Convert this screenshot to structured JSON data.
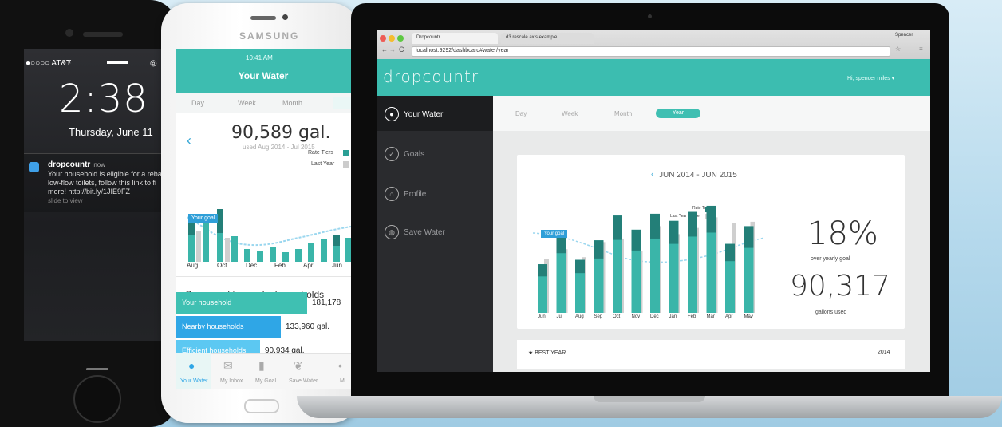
{
  "iphone": {
    "carrier": "●○○○○ AT&T",
    "time": "2:38",
    "date": "Thursday, June 11",
    "notification": {
      "app": "dropcountr",
      "age": "now",
      "lines": [
        "Your household is eligible for a reba",
        "low-flow toilets, follow this link to fi",
        "more!  http://bit.ly/1JIE9FZ"
      ],
      "hint": "slide to view"
    }
  },
  "samsung": {
    "brand": "SAMSUNG",
    "status_time": "10:41 AM",
    "title": "Your Water",
    "tabs": [
      "Day",
      "Week",
      "Month"
    ],
    "total": "90,589 gal.",
    "range": "used Aug 2014 - Jul 2015",
    "legend": [
      "Rate Tiers",
      "Last Year"
    ],
    "goal_label": "Your goal",
    "months": [
      "Aug",
      "Oct",
      "Dec",
      "Feb",
      "Apr",
      "Jun"
    ],
    "compare_title": "Compared to nearby households",
    "compare": [
      {
        "label": "Your household",
        "value": "181,178",
        "fill": 0.75,
        "color": "#3fc0b2"
      },
      {
        "label": "Nearby households",
        "value": "133,960 gal.",
        "fill": 0.6,
        "color": "#2fa6e6"
      },
      {
        "label": "Efficient households",
        "value": "90,934 gal.",
        "fill": 0.48,
        "color": "#5cc8f2"
      }
    ],
    "nav": [
      "Your Water",
      "My Inbox",
      "My Goal",
      "Save Water",
      "M"
    ]
  },
  "laptop": {
    "tabs": [
      "Dropcountr",
      "d3 rescale axis example"
    ],
    "user_chip": "Spencer",
    "url": "localhost:9292/dashboard#water/year",
    "logo": "dropcountr",
    "greeting": "Hi, spencer miles ▾",
    "sidebar": [
      {
        "label": "Your Water",
        "icon": "water-drop-icon"
      },
      {
        "label": "Goals",
        "icon": "check-icon"
      },
      {
        "label": "Profile",
        "icon": "home-icon"
      },
      {
        "label": "Save Water",
        "icon": "globe-icon"
      }
    ],
    "period_tabs": [
      "Day",
      "Week",
      "Month",
      "Year"
    ],
    "range": "JUN 2014 - JUN 2015",
    "goal_label": "Your goal",
    "legend": [
      "Rate Tiers",
      "Last Year Usage"
    ],
    "percent": "18%",
    "percent_caption": "over yearly goal",
    "gallons": "90,317",
    "gallons_caption": "gallons used",
    "best_label": "★ BEST YEAR",
    "best_year": "2014"
  },
  "chart_data": {
    "type": "bar",
    "categories": [
      "Jun",
      "Jul",
      "Aug",
      "Sep",
      "Oct",
      "Nov",
      "Dec",
      "Jan",
      "Feb",
      "Mar",
      "Apr",
      "May"
    ],
    "series": [
      {
        "name": "Rate Tiers",
        "values": [
          5.5,
          9.0,
          6.0,
          8.2,
          11.0,
          9.4,
          11.2,
          10.4,
          11.5,
          12.1,
          7.8,
          9.8
        ]
      },
      {
        "name": "Last Year Usage",
        "values": [
          6.1,
          7.2,
          6.3,
          8.0,
          8.4,
          7.0,
          9.8,
          8.9,
          9.6,
          10.8,
          10.2,
          10.3
        ]
      }
    ],
    "colors": {
      "light": "#3ab5a9",
      "dark": "#237f78",
      "last_year": "#cfcfcf",
      "goal_line": "#9bd7ef"
    }
  }
}
